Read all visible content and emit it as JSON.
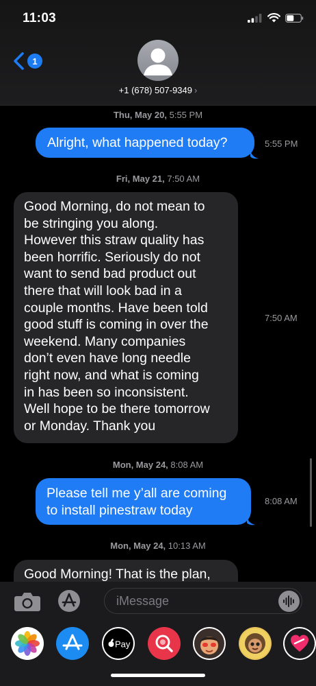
{
  "status_bar": {
    "time": "11:03"
  },
  "header": {
    "back_badge": "1",
    "contact": "+1 (678) 507-9349",
    "contact_chevron": "›"
  },
  "thread": {
    "timestamps": [
      {
        "day": "Thu, May 20,",
        "time": "5:55 PM"
      },
      {
        "day": "Fri, May 21,",
        "time": "7:50 AM"
      },
      {
        "day": "Mon, May 24,",
        "time": "8:08 AM"
      },
      {
        "day": "Mon, May 24,",
        "time": "10:13 AM"
      }
    ],
    "messages": [
      {
        "direction": "outgoing",
        "time": "5:55 PM",
        "lines": [
          "Alright, what happened today?"
        ]
      },
      {
        "direction": "incoming",
        "time": "7:50 AM",
        "lines": [
          "Good Morning, do not mean to",
          "be stringing you along.",
          "However this straw quality has",
          "been horrific. Seriously do not",
          "want to send bad product out",
          "there that will look bad in a",
          "couple months. Have been told",
          "good stuff is coming in over the",
          "weekend. Many companies",
          "don’t even have long needle",
          "right now, and what is coming",
          "in has been so inconsistent.",
          "Well hope to be there tomorrow",
          "or Monday. Thank you"
        ]
      },
      {
        "direction": "outgoing",
        "time": "8:08 AM",
        "lines": [
          "Please tell me y’all are coming",
          "to install pinestraw today"
        ]
      },
      {
        "direction": "incoming",
        "time": "",
        "lines": [
          "Good Morning! That is the plan,"
        ]
      }
    ]
  },
  "input_bar": {
    "placeholder": "iMessage"
  },
  "app_drawer": {
    "apps": [
      {
        "name": "Photos",
        "icon": "photos-icon"
      },
      {
        "name": "App Store",
        "icon": "app-store-icon"
      },
      {
        "name": "Apple Pay",
        "label": "Pay",
        "icon": "apple-pay-icon"
      },
      {
        "name": "Image Search",
        "icon": "image-search-icon"
      },
      {
        "name": "Memoji Stickers",
        "icon": "memoji-icon"
      },
      {
        "name": "Animoji",
        "icon": "animoji-icon"
      },
      {
        "name": "Digital Touch",
        "icon": "digital-touch-icon"
      }
    ]
  },
  "colors": {
    "outgoing_bubble": "#1f7cf5",
    "incoming_bubble": "#262628",
    "accent": "#1e7cf2",
    "secondary_text": "#9a9a9f"
  }
}
